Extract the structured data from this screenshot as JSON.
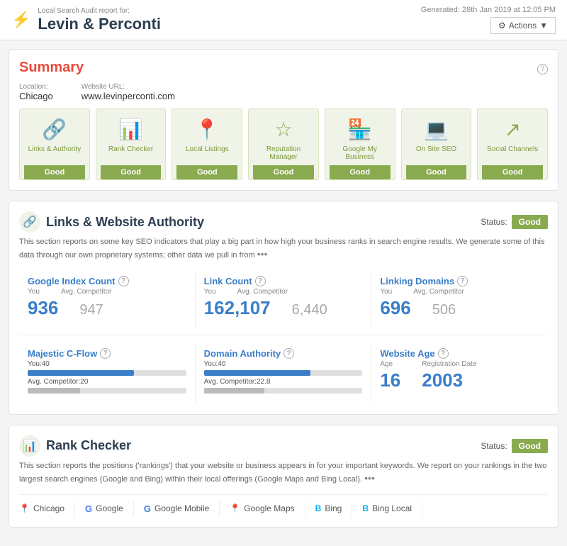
{
  "header": {
    "subtitle": "Local Search Audit report for:",
    "title": "Levin & Perconti",
    "generated": "Generated: 28th Jan 2019 at 12:05 PM",
    "actions_label": "Actions",
    "logo_icon": "♥"
  },
  "summary": {
    "section_title": "Summary",
    "location_label": "Location:",
    "location_value": "Chicago",
    "website_label": "Website URL:",
    "website_value": "www.levinperconti.com",
    "items": [
      {
        "label": "Links & Authority",
        "badge": "Good",
        "icon": "🔗"
      },
      {
        "label": "Rank Checker",
        "badge": "Good",
        "icon": "📊"
      },
      {
        "label": "Local Listings",
        "badge": "Good",
        "icon": "📍"
      },
      {
        "label": "Reputation Manager",
        "badge": "Good",
        "icon": "☆"
      },
      {
        "label": "Google My Business",
        "badge": "Good",
        "icon": "🏪"
      },
      {
        "label": "On Site SEO",
        "badge": "Good",
        "icon": "💻"
      },
      {
        "label": "Social Channels",
        "badge": "Good",
        "icon": "↗"
      }
    ]
  },
  "links_authority": {
    "section_title": "Links & Website Authority",
    "status_label": "Status:",
    "status_value": "Good",
    "description": "This section reports on some key SEO indicators that play a big part in how high your business ranks in search engine results. We generate some of this data through our own proprietary systems; other data we pull in from",
    "metrics": {
      "google_index": {
        "title": "Google Index Count",
        "you_label": "You",
        "competitor_label": "Avg. Competitor",
        "you_value": "936",
        "competitor_value": "947"
      },
      "link_count": {
        "title": "Link Count",
        "you_label": "You",
        "competitor_label": "Avg. Competitor",
        "you_value": "162,107",
        "competitor_value": "6,440"
      },
      "linking_domains": {
        "title": "Linking Domains",
        "you_label": "You",
        "competitor_label": "Avg. Competitor",
        "you_value": "696",
        "competitor_value": "506"
      },
      "majestic_cflow": {
        "title": "Majestic C-Flow",
        "you_label": "You:40",
        "competitor_label": "Avg. Competitor:20",
        "you_pct": 67,
        "competitor_pct": 33
      },
      "domain_authority": {
        "title": "Domain Authority",
        "you_label": "You:40",
        "competitor_label": "Avg. Competitor:22.8",
        "you_pct": 67,
        "competitor_pct": 38
      },
      "website_age": {
        "title": "Website Age",
        "age_label": "Age",
        "age_value": "16",
        "reg_label": "Registration Date",
        "reg_value": "2003"
      }
    }
  },
  "rank_checker": {
    "section_title": "Rank Checker",
    "status_label": "Status:",
    "status_value": "Good",
    "description": "This section reports the positions ('rankings') that your website or business appears in for your important keywords. We report on your rankings in the two largest search engines (Google and Bing) within their local offerings (Google Maps and Bing Local).",
    "tabs": [
      {
        "label": "Chicago",
        "icon": "📍"
      },
      {
        "label": "Google",
        "icon": "G"
      },
      {
        "label": "Google Mobile",
        "icon": "G"
      },
      {
        "label": "Google Maps",
        "icon": "📍"
      },
      {
        "label": "Bing",
        "icon": "B"
      },
      {
        "label": "Bing Local",
        "icon": "B"
      }
    ]
  }
}
